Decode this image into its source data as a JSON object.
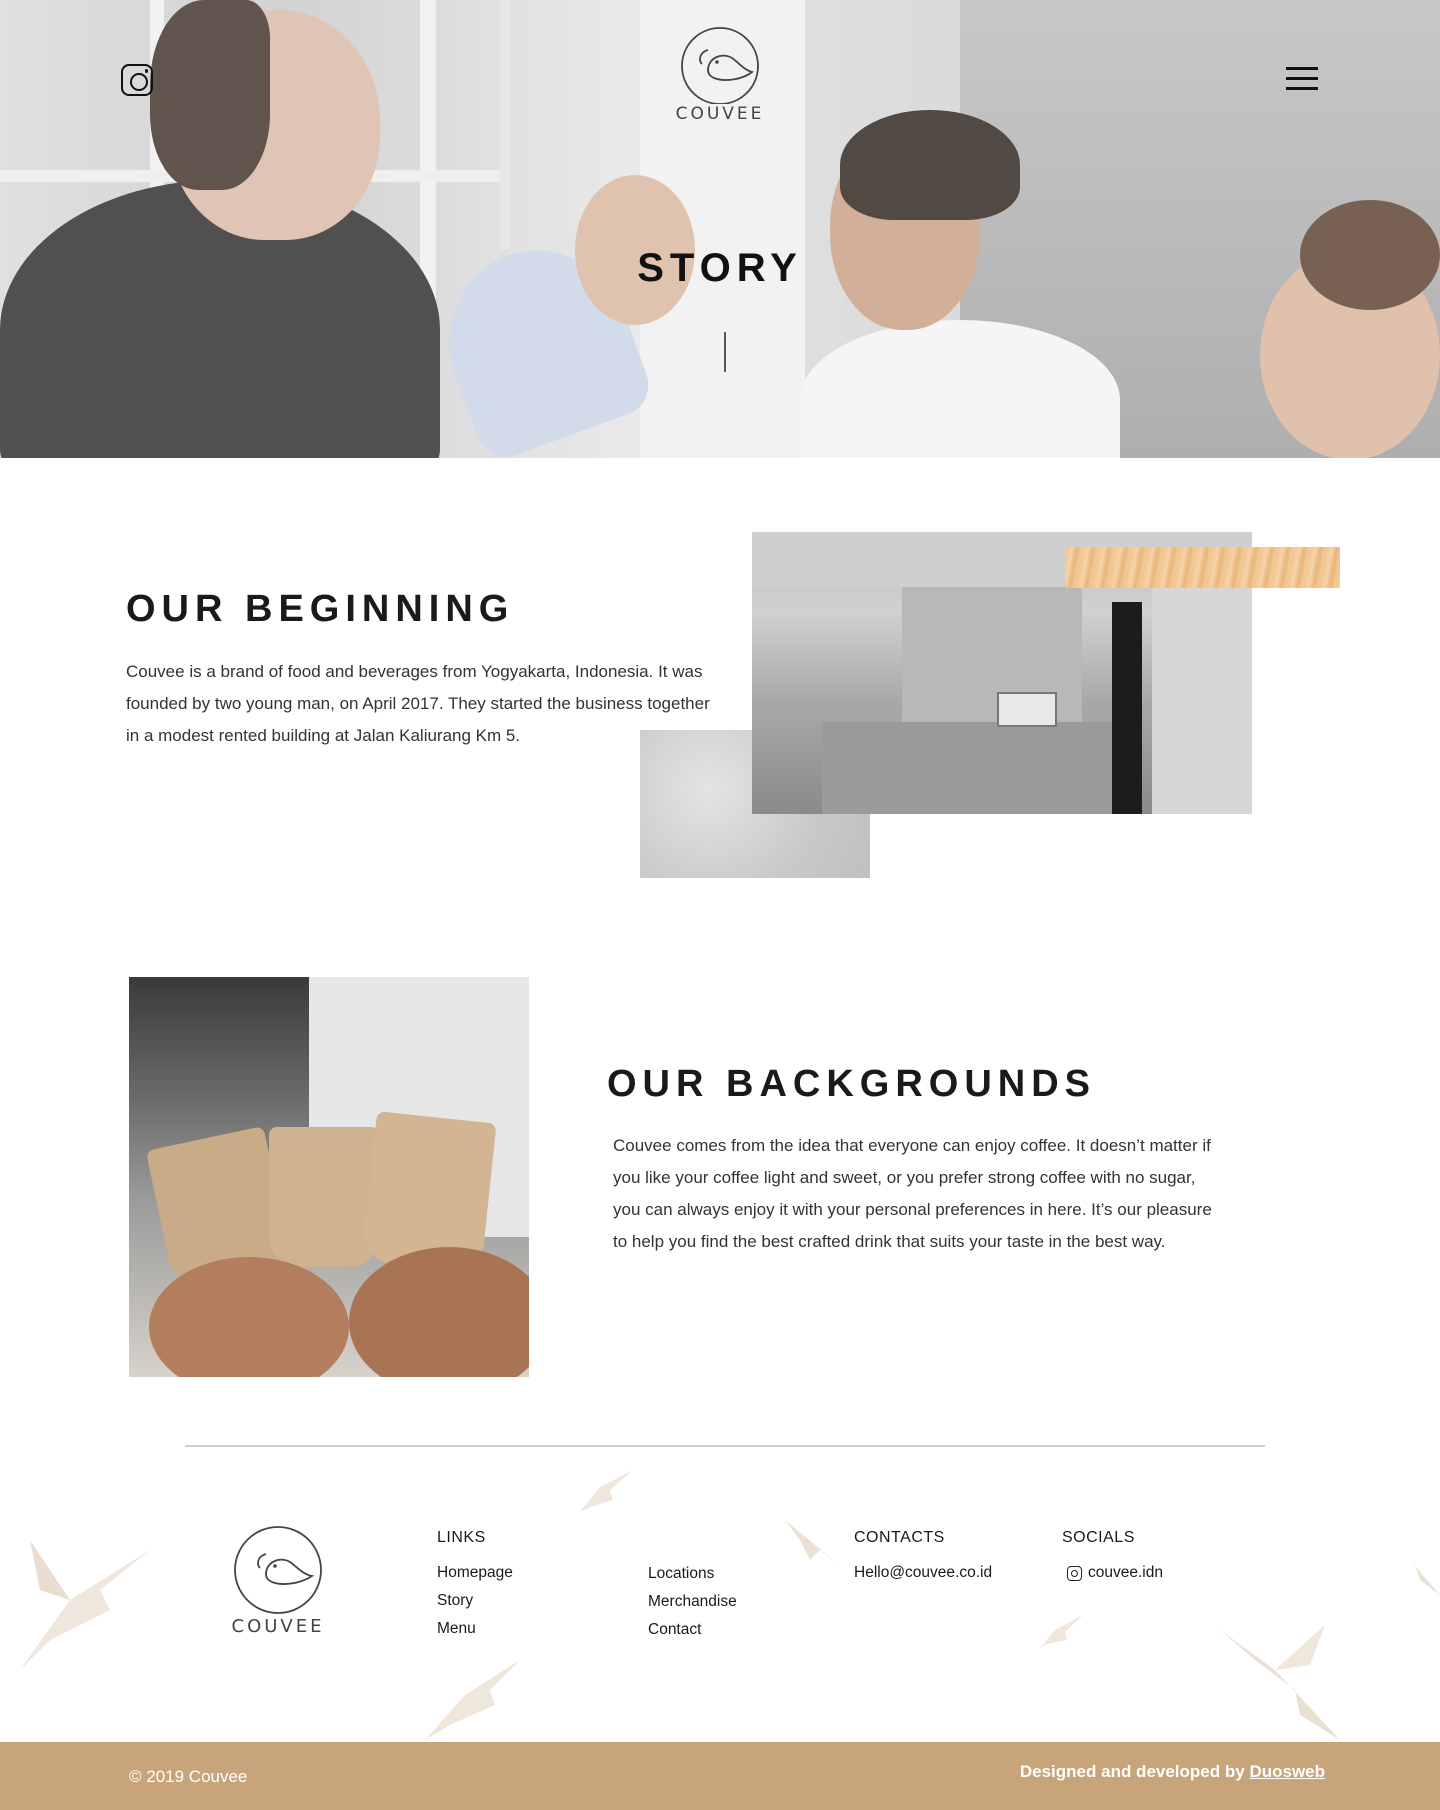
{
  "brand": {
    "name": "COUVEE"
  },
  "header": {
    "instagram_icon": "instagram-icon",
    "menu_icon": "hamburger-icon"
  },
  "hero": {
    "title": "STORY"
  },
  "beginning": {
    "title": "OUR BEGINNING",
    "text": "Couvee is a brand of food and beverages from Yogyakarta, Indonesia. It was founded by two young man, on April 2017.  They started the business together in a modest rented building at Jalan Kaliurang Km 5."
  },
  "backgrounds": {
    "title": "OUR BACKGROUNDS",
    "text": "Couvee comes from the idea that everyone can enjoy coffee. It doesn’t matter if you like your coffee light and sweet, or you prefer strong coffee with no sugar, you can always enjoy it with your personal preferences in here. It’s our pleasure to help you find the best crafted drink that suits your taste in the best way."
  },
  "footer": {
    "links_heading": "LINKS",
    "links_col1": [
      "Homepage",
      "Story",
      "Menu"
    ],
    "links_col2": [
      "Locations",
      "Merchandise",
      "Contact"
    ],
    "contacts_heading": "CONTACTS",
    "email": "Hello@couvee.co.id",
    "socials_heading": "SOCIALS",
    "instagram_handle": "couvee.idn",
    "copyright": "© 2019 Couvee",
    "credits_prefix": "Designed and developed by",
    "credits_link": "Duosweb",
    "bar_color": "#c8a47a"
  }
}
